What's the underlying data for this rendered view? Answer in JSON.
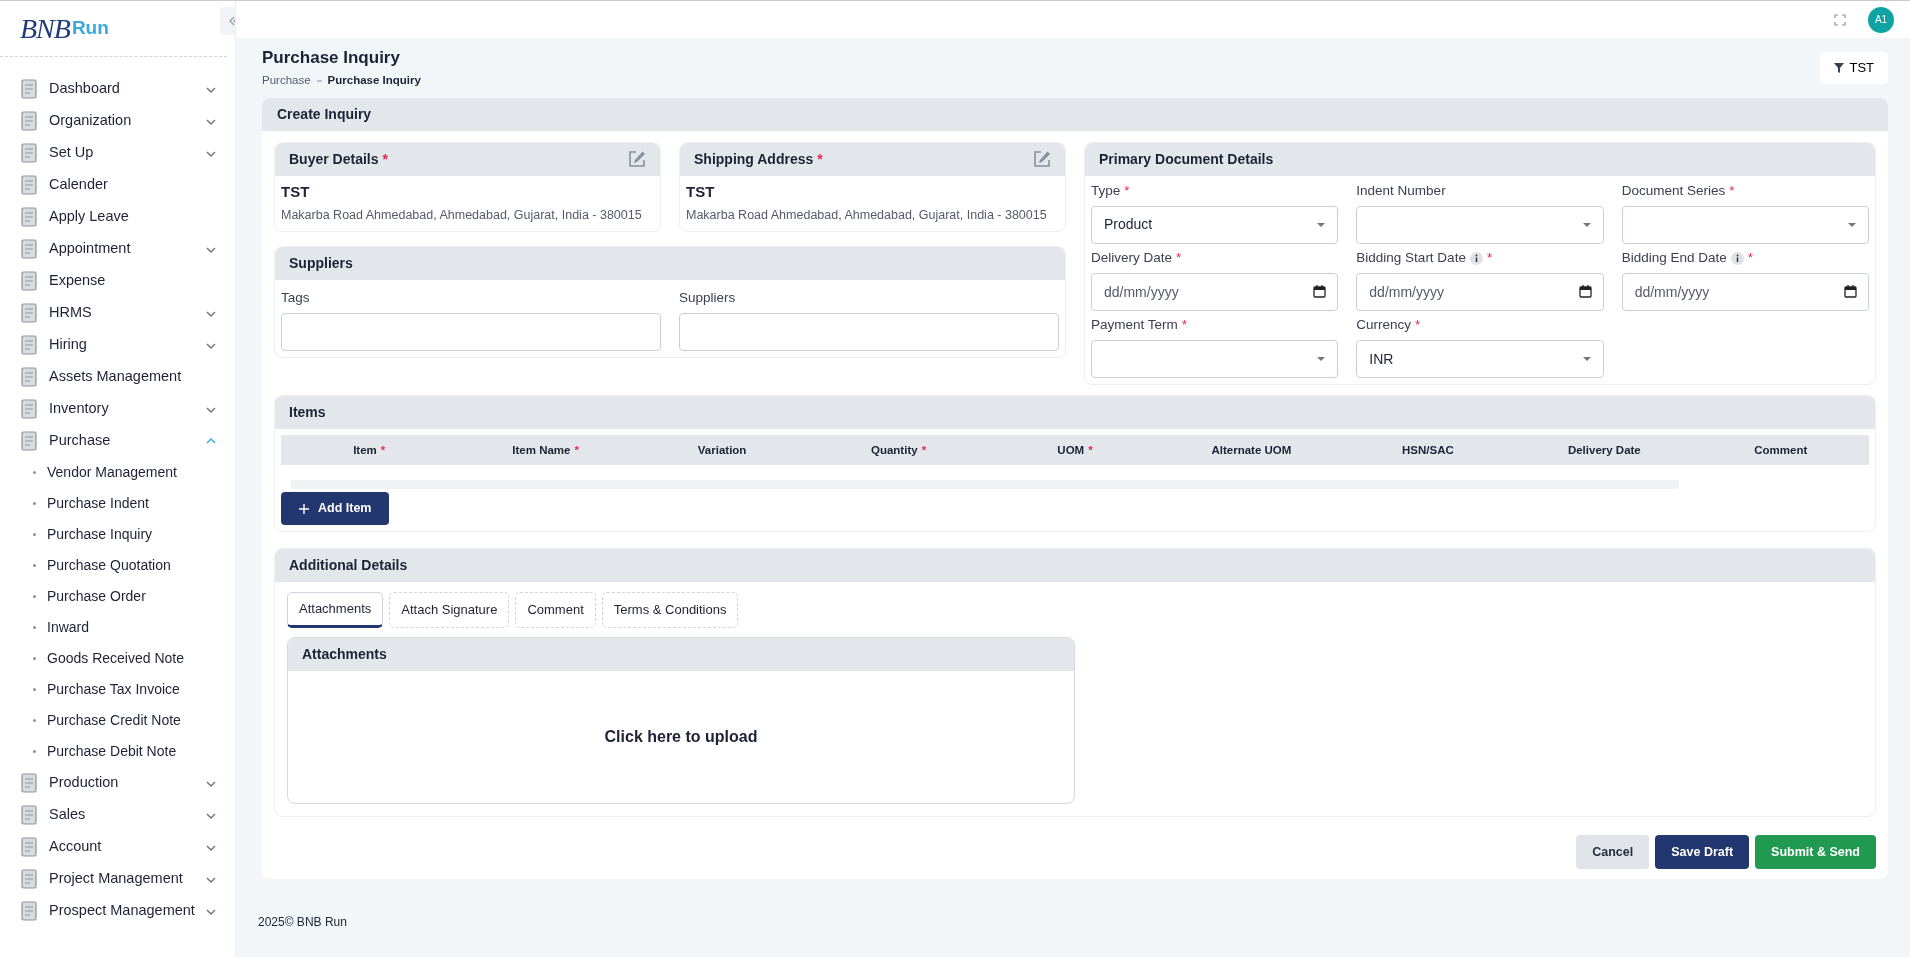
{
  "logo": {
    "mark": "BNB",
    "word": "Run"
  },
  "sidebar": {
    "items": [
      {
        "label": "Dashboard",
        "expandable": true,
        "expanded": false
      },
      {
        "label": "Organization",
        "expandable": true,
        "expanded": false
      },
      {
        "label": "Set Up",
        "expandable": true,
        "expanded": false
      },
      {
        "label": "Calender",
        "expandable": false
      },
      {
        "label": "Apply Leave",
        "expandable": false
      },
      {
        "label": "Appointment",
        "expandable": true,
        "expanded": false
      },
      {
        "label": "Expense",
        "expandable": false
      },
      {
        "label": "HRMS",
        "expandable": true,
        "expanded": false
      },
      {
        "label": "Hiring",
        "expandable": true,
        "expanded": false
      },
      {
        "label": "Assets Management",
        "expandable": false
      },
      {
        "label": "Inventory",
        "expandable": true,
        "expanded": false
      },
      {
        "label": "Purchase",
        "expandable": true,
        "expanded": true,
        "children": [
          {
            "label": "Vendor Management"
          },
          {
            "label": "Purchase Indent"
          },
          {
            "label": "Purchase Inquiry"
          },
          {
            "label": "Purchase Quotation"
          },
          {
            "label": "Purchase Order"
          },
          {
            "label": "Inward"
          },
          {
            "label": "Goods Received Note"
          },
          {
            "label": "Purchase Tax Invoice"
          },
          {
            "label": "Purchase Credit Note"
          },
          {
            "label": "Purchase Debit Note"
          }
        ]
      },
      {
        "label": "Production",
        "expandable": true,
        "expanded": false
      },
      {
        "label": "Sales",
        "expandable": true,
        "expanded": false
      },
      {
        "label": "Account",
        "expandable": true,
        "expanded": false
      },
      {
        "label": "Project Management",
        "expandable": true,
        "expanded": false
      },
      {
        "label": "Prospect Management",
        "expandable": true,
        "expanded": false
      }
    ]
  },
  "topbar": {
    "avatar": "A1"
  },
  "page": {
    "title": "Purchase Inquiry",
    "breadcrumb": [
      "Purchase",
      "Purchase Inquiry"
    ],
    "filter_button": "TST"
  },
  "form": {
    "title": "Create Inquiry",
    "addresses": [
      {
        "title": "Buyer Details",
        "required_mark": "*",
        "name": "TST",
        "address": "Makarba Road Ahmedabad, Ahmedabad, Gujarat, India - 380015"
      },
      {
        "title": "Shipping Address",
        "required_mark": "*",
        "name": "TST",
        "address": "Makarba Road Ahmedabad, Ahmedabad, Gujarat, India - 380015"
      }
    ],
    "suppliers": {
      "title": "Suppliers",
      "fields": [
        {
          "label": "Tags"
        },
        {
          "label": "Suppliers"
        }
      ]
    },
    "primary": {
      "title": "Primary Document Details",
      "fields": [
        {
          "label": "Type",
          "required_mark": "*",
          "kind": "select",
          "value": "Product"
        },
        {
          "label": "Indent Number",
          "kind": "select"
        },
        {
          "label": "Document Series",
          "required_mark": "*",
          "kind": "select"
        },
        {
          "label": "Delivery Date",
          "required_mark": "*",
          "kind": "date",
          "placeholder": "dd/mm/yyyy"
        },
        {
          "label": "Bidding Start Date",
          "required_mark": "*",
          "kind": "date",
          "placeholder": "dd/mm/yyyy",
          "info": true
        },
        {
          "label": "Bidding End Date",
          "required_mark": "*",
          "kind": "date",
          "placeholder": "dd/mm/yyyy",
          "info": true
        },
        {
          "label": "Payment Term",
          "required_mark": "*",
          "kind": "select"
        },
        {
          "label": "Currency",
          "required_mark": "*",
          "kind": "select",
          "value": "INR"
        }
      ]
    },
    "items": {
      "title": "Items",
      "columns": [
        {
          "label": "Item",
          "required_mark": "*"
        },
        {
          "label": "Item Name",
          "required_mark": "*"
        },
        {
          "label": "Variation"
        },
        {
          "label": "Quantity",
          "required_mark": "*"
        },
        {
          "label": "UOM",
          "required_mark": "*"
        },
        {
          "label": "Alternate UOM"
        },
        {
          "label": "HSN/SAC"
        },
        {
          "label": "Delivery Date"
        },
        {
          "label": "Comment"
        }
      ],
      "add_button": "Add Item"
    },
    "additional": {
      "title": "Additional Details",
      "tabs": [
        {
          "label": "Attachments",
          "selected": true
        },
        {
          "label": "Attach Signature",
          "selected": false
        },
        {
          "label": "Comment",
          "selected": false
        },
        {
          "label": "Terms & Conditions",
          "selected": false
        }
      ],
      "panel_title": "Attachments",
      "upload_text": "Click here to upload"
    },
    "buttons": [
      {
        "label": "Cancel",
        "kind": "secondary"
      },
      {
        "label": "Save Draft",
        "kind": "primary"
      },
      {
        "label": "Submit & Send",
        "kind": "success"
      }
    ]
  },
  "footer": "2025© BNB Run"
}
